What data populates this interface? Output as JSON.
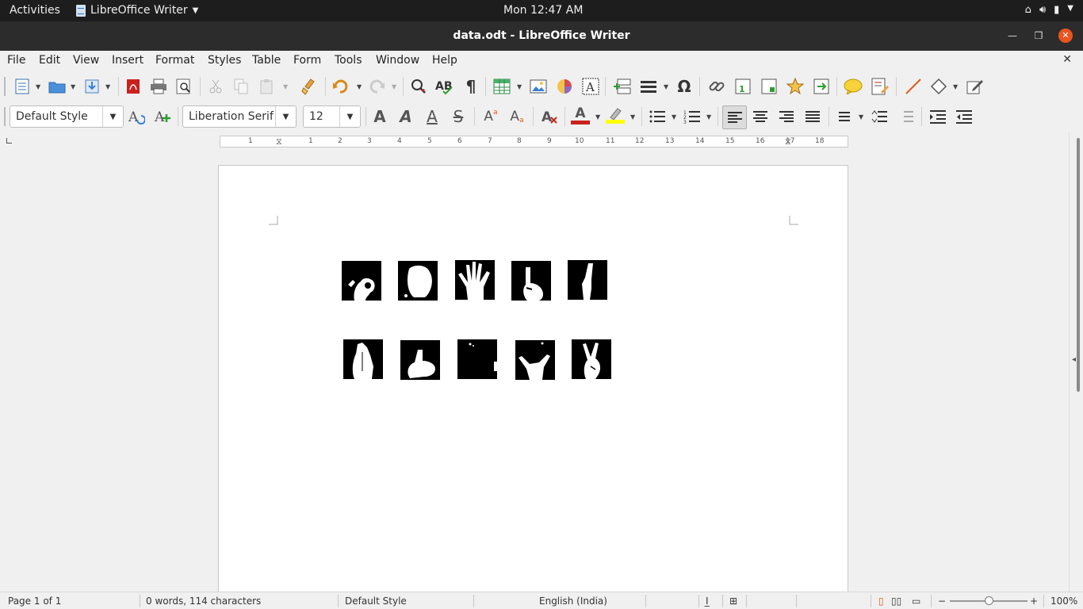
{
  "topbar": {
    "activities": "Activities",
    "app_name": "LibreOffice Writer",
    "clock": "Mon 12:47 AM"
  },
  "window": {
    "title": "data.odt - LibreOffice Writer"
  },
  "menu": [
    "File",
    "Edit",
    "View",
    "Insert",
    "Format",
    "Styles",
    "Table",
    "Form",
    "Tools",
    "Window",
    "Help"
  ],
  "formatting": {
    "paragraph_style": "Default Style",
    "font_name": "Liberation Serif",
    "font_size": "12"
  },
  "ruler": {
    "numbers": [
      "1",
      "1",
      "2",
      "3",
      "4",
      "5",
      "6",
      "7",
      "8",
      "9",
      "10",
      "11",
      "12",
      "13",
      "14",
      "15",
      "16",
      "17",
      "18"
    ]
  },
  "document": {
    "images_row1": [
      "ok-hand",
      "fist",
      "open-palm",
      "index-up",
      "one-finger"
    ],
    "images_row2": [
      "palm-side",
      "thumbs-up",
      "blank",
      "horns",
      "peace"
    ]
  },
  "statusbar": {
    "page": "Page 1 of 1",
    "words": "0 words, 114 characters",
    "style": "Default Style",
    "language": "English (India)",
    "zoom": "100%"
  },
  "colors": {
    "accent_close": "#e95420",
    "font_color": "#c9211e",
    "highlight": "#ffff00",
    "topbar_bg": "#1d1d1d",
    "titlebar_bg": "#2c2c2c"
  }
}
